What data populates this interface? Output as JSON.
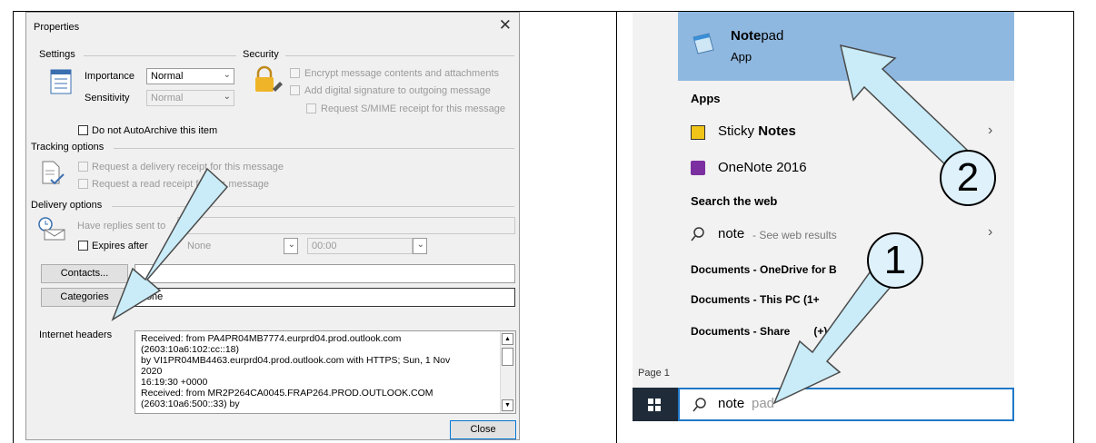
{
  "dialog": {
    "title": "Properties",
    "close_glyph": "✕",
    "settings": {
      "heading": "Settings",
      "importance_label": "Importance",
      "importance_value": "Normal",
      "sensitivity_label": "Sensitivity",
      "sensitivity_value": "Normal",
      "autoarchive_label": "Do not AutoArchive this item"
    },
    "security": {
      "heading": "Security",
      "encrypt_label": "Encrypt message contents and attachments",
      "signature_label": "Add digital signature to outgoing message",
      "smime_label": "Request S/MIME receipt for this message"
    },
    "tracking": {
      "heading": "Tracking options",
      "delivery_label": "Request a delivery receipt for this message",
      "read_label": "Request a read receipt for this message"
    },
    "delivery": {
      "heading": "Delivery options",
      "replies_label": "Have replies sent to",
      "expires_label": "Expires after",
      "expires_date": "None",
      "expires_time": "00:00"
    },
    "contacts_button": "Contacts...",
    "categories_button": "Categories",
    "categories_value": "None",
    "internet_headers_label": "Internet headers",
    "internet_headers_lines": [
      "Received: from PA4PR04MB7774.eurprd04.prod.outlook.com",
      "(2603:10a6:102:cc::18)",
      " by VI1PR04MB4463.eurprd04.prod.outlook.com with HTTPS; Sun, 1 Nov",
      "2020",
      " 16:19:30 +0000",
      "Received: from MR2P264CA0045.FRAP264.PROD.OUTLOOK.COM",
      "(2603:10a6:500::33) by"
    ],
    "close_button": "Close"
  },
  "start_menu": {
    "best_match": {
      "name_bold": "Note",
      "name_rest": "pad",
      "type": "App"
    },
    "apps_heading": "Apps",
    "apps": [
      {
        "prefix": "Sticky ",
        "bold": "Notes",
        "has_arrow": true
      },
      {
        "prefix": "OneNote 2016",
        "bold": "",
        "has_arrow": false
      }
    ],
    "web_heading": "Search the web",
    "web_query": "note",
    "web_hint": " - See web results",
    "documents": [
      "Documents - OneDrive for B",
      "Documents - This PC (1+",
      "Documents - Share",
      "(+)"
    ],
    "page_label": "Page 1",
    "search_typed": "note",
    "search_suggest": "pad"
  },
  "callouts": [
    "1",
    "2"
  ],
  "colors": {
    "dialog_bg": "#f0f0f0",
    "highlight": "#8fb8e0",
    "arrow_fill": "#c9ecf8",
    "taskbar": "#1f2b38",
    "search_border": "#1f78c8"
  },
  "icons": [
    "settings-icon",
    "lock-icon",
    "tracking-icon",
    "delivery-icon",
    "notepad-icon",
    "sticky-notes-icon",
    "onenote-icon",
    "search-icon",
    "windows-icon"
  ]
}
